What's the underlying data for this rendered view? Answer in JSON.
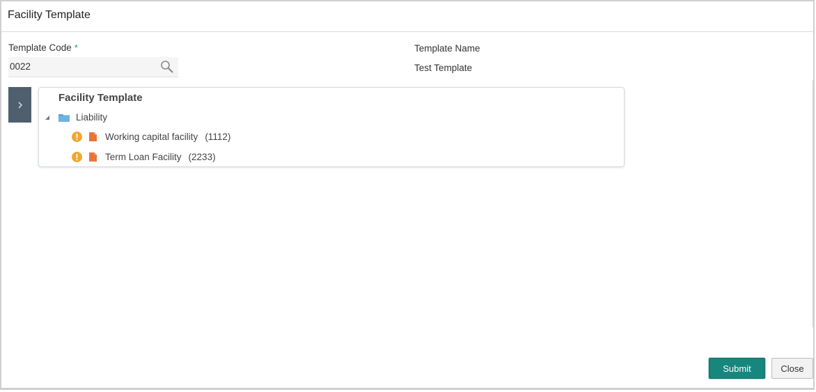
{
  "header": {
    "title": "Facility Template"
  },
  "form": {
    "template_code_label": "Template Code",
    "required_marker": "*",
    "template_code_value": "0022",
    "template_name_label": "Template Name",
    "template_name_value": "Test Template"
  },
  "tree": {
    "title": "Facility Template",
    "root": {
      "label": "Liability",
      "children": [
        {
          "label": "Working capital facility",
          "count": "(1112)"
        },
        {
          "label": "Term Loan Facility",
          "count": "(2233)"
        }
      ]
    }
  },
  "buttons": {
    "submit": "Submit",
    "close": "Close"
  },
  "colors": {
    "accent": "#17867c",
    "side_panel": "#4f5f6d",
    "warning": "#f0a830",
    "document": "#e8753a",
    "folder": "#5ba3d6"
  },
  "icons": {
    "search": "search-icon",
    "expand": "chevron-right-icon",
    "collapse": "caret-down-icon",
    "folder": "folder-icon",
    "warning": "warning-icon",
    "document": "document-icon"
  }
}
